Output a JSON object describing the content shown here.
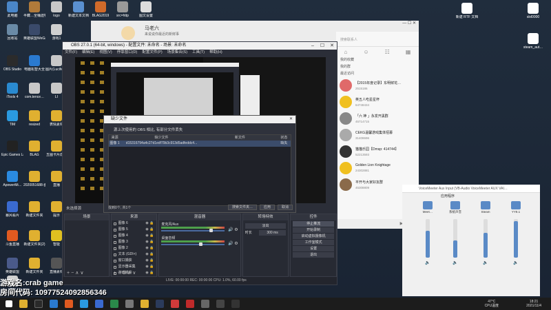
{
  "desktop_icons": [
    {
      "label": "此电脑",
      "color": "#4a86c8"
    },
    {
      "label": "半藏…全桶遗物腐朽中文",
      "color": "#b07a3a"
    },
    {
      "label": "logo",
      "color": "#c8c8c8"
    },
    {
      "label": "新建文本文档",
      "color": "#5a90d0"
    },
    {
      "label": "BLAG2019",
      "color": "#d06a2a"
    },
    {
      "label": "src=http",
      "color": "#999999"
    },
    {
      "label": "图文设置",
      "color": "#dddddd"
    },
    {
      "label": "回收站",
      "color": "#6a8aa6"
    },
    {
      "label": "英雄联盟WeGame版",
      "color": "#3a4a6a"
    },
    {
      "label": "游戏1",
      "color": "#d0d0d0"
    },
    {
      "label": "OBS Studio",
      "color": "#2b2b2b"
    },
    {
      "label": "电脑机智大全",
      "color": "#2a7ad0"
    },
    {
      "label": "图片(Lucifer剪)",
      "color": "#c8c8c8"
    },
    {
      "label": "iTools 4",
      "color": "#2a8ad0"
    },
    {
      "label": "com.tence…",
      "color": "#c8c8c8"
    },
    {
      "label": "LI",
      "color": "#c8c8c8"
    },
    {
      "label": "TIM",
      "color": "#2a9ae0"
    },
    {
      "label": "resized",
      "color": "#e0b030"
    },
    {
      "label": "表情素材",
      "color": "#e0b030"
    },
    {
      "label": "Epic Games Launcher",
      "color": "#222222"
    },
    {
      "label": "BLAG",
      "color": "#e0b030"
    },
    {
      "label": "五图卡片成像",
      "color": "#e0b030"
    },
    {
      "label": "ApowerMi…",
      "color": "#2a8ae0"
    },
    {
      "label": "2020051688-图新设计",
      "color": "#e0b030"
    },
    {
      "label": "直播",
      "color": "#e0b030"
    },
    {
      "label": "暴风看片",
      "color": "#3a6ad0"
    },
    {
      "label": "新建文件夹",
      "color": "#e0b030"
    },
    {
      "label": "提示",
      "color": "#e0b030"
    },
    {
      "label": "斗鱼直播",
      "color": "#e05a20"
    },
    {
      "label": "新建文件夹(2)",
      "color": "#e0b030"
    },
    {
      "label": "智能",
      "color": "#e0c020"
    },
    {
      "label": "英雄联盟",
      "color": "#4a5a8a"
    },
    {
      "label": "新建文件夹",
      "color": "#e0b030"
    },
    {
      "label": "直播素材",
      "color": "#555555"
    },
    {
      "label": "游戏",
      "color": "#d0d0d0"
    }
  ],
  "desktop_icons_right": [
    {
      "label": "新建 RTF 文档",
      "color": "#ffffff"
    },
    {
      "label": "slxl0000",
      "color": "#ffffff"
    },
    {
      "label": "steam_aut…",
      "color": "#ffffff"
    }
  ],
  "browser": {
    "name": "马老六",
    "subtitle": "来说说你最近的新鲜事"
  },
  "obs": {
    "title": "OBS 27.0.1 (64-bit, windows) - 配置文件: 未命名 - 场景: 未命名",
    "menu": [
      "文件(F)",
      "编辑(E)",
      "视图(V)",
      "停靠窗口(D)",
      "配置文件(P)",
      "场景集合(S)",
      "工具(T)",
      "帮助(H)"
    ],
    "status_line": "未选择源",
    "docks": {
      "scenes_header": "场景",
      "sources_header": "来源",
      "mixer_header": "混音器",
      "transitions_header": "转场特效",
      "controls_header": "控件"
    },
    "sources": [
      {
        "name": "图像 6"
      },
      {
        "name": "图像 5"
      },
      {
        "name": "图像 4"
      },
      {
        "name": "图像 3"
      },
      {
        "name": "图像 2"
      },
      {
        "name": "文本 (GDI+)"
      },
      {
        "name": "窗口捕获"
      },
      {
        "name": "显示器采集"
      },
      {
        "name": "游戏捕获"
      }
    ],
    "mixer": [
      {
        "label": "麦克风/Aux",
        "level": 0.78
      },
      {
        "label": "桌面音频",
        "level": 0.62
      }
    ],
    "transition": {
      "type": "淡出",
      "duration_label": "时长",
      "duration": "300 ms"
    },
    "controls": [
      "停止推流",
      "开始录制",
      "启动虚拟摄像机",
      "工作室模式",
      "设置",
      "退出"
    ],
    "status_bar": "LIVE: 00:00:00   REC: 00:00:00   CPU: 1.0%, 60.00 fps"
  },
  "missing_dialog": {
    "title": "缺少文件",
    "message": "源上次使用的 OBS 相比, 有部分文件丢失",
    "headers": [
      "来源",
      "缺少文件",
      "新文件",
      "状态"
    ],
    "rows": [
      {
        "source": "图像 1",
        "missing": "d15316794a4c27d1edf79b3c913d5adfeddc4...",
        "new": "",
        "status": "缺失"
      }
    ],
    "count": "找到0个, 共1个",
    "buttons": [
      "搜索文件夹…",
      "应用",
      "取消"
    ]
  },
  "chat": {
    "search_placeholder": "搜索联系人",
    "groups": [
      "我的收藏",
      "我的群",
      "最近访问"
    ],
    "items": [
      {
        "title": "【2015年度记录】东明鲜花…",
        "sub": "2515186",
        "color": "#e06a6a"
      },
      {
        "title": "英五人吃星星杯",
        "sub": "64748434",
        "color": "#f0c020"
      },
      {
        "title": "「六 神 」永发开黑群",
        "sub": "45714715",
        "color": "#888888"
      },
      {
        "title": "CEKG温馨游戏集体招募",
        "sub": "31408696",
        "color": "#aaaaaa"
      },
      {
        "title": "猫猫乐园【Dmsp: 414744】",
        "sub": "52213593",
        "color": "#333333"
      },
      {
        "title": "Golden Lion Knightage",
        "sub": "24302881",
        "color": "#f0c020"
      },
      {
        "title": "平开与大家好友群",
        "sub": "45308809",
        "color": "#8a6a4a"
      }
    ]
  },
  "voicemeeter": {
    "title": "VoiceMeeter Aux Input (VB-Audio VoiceMeeter AUX VAI…",
    "section": "应用程序",
    "channels": [
      {
        "name": "Meet…",
        "level": 0.7
      },
      {
        "name": "系统声音",
        "level": 0.45
      },
      {
        "name": "Steam",
        "level": 0.65
      },
      {
        "name": "YY8.1",
        "level": 0.95
      }
    ]
  },
  "overlay": {
    "game": "游戏名:crab game",
    "room": "房间代码: 10977524092856346"
  },
  "taskbar": {
    "temperature": "47°C",
    "temp_label": "CPU温度",
    "time": "18:21",
    "date": "2021/11/4"
  }
}
